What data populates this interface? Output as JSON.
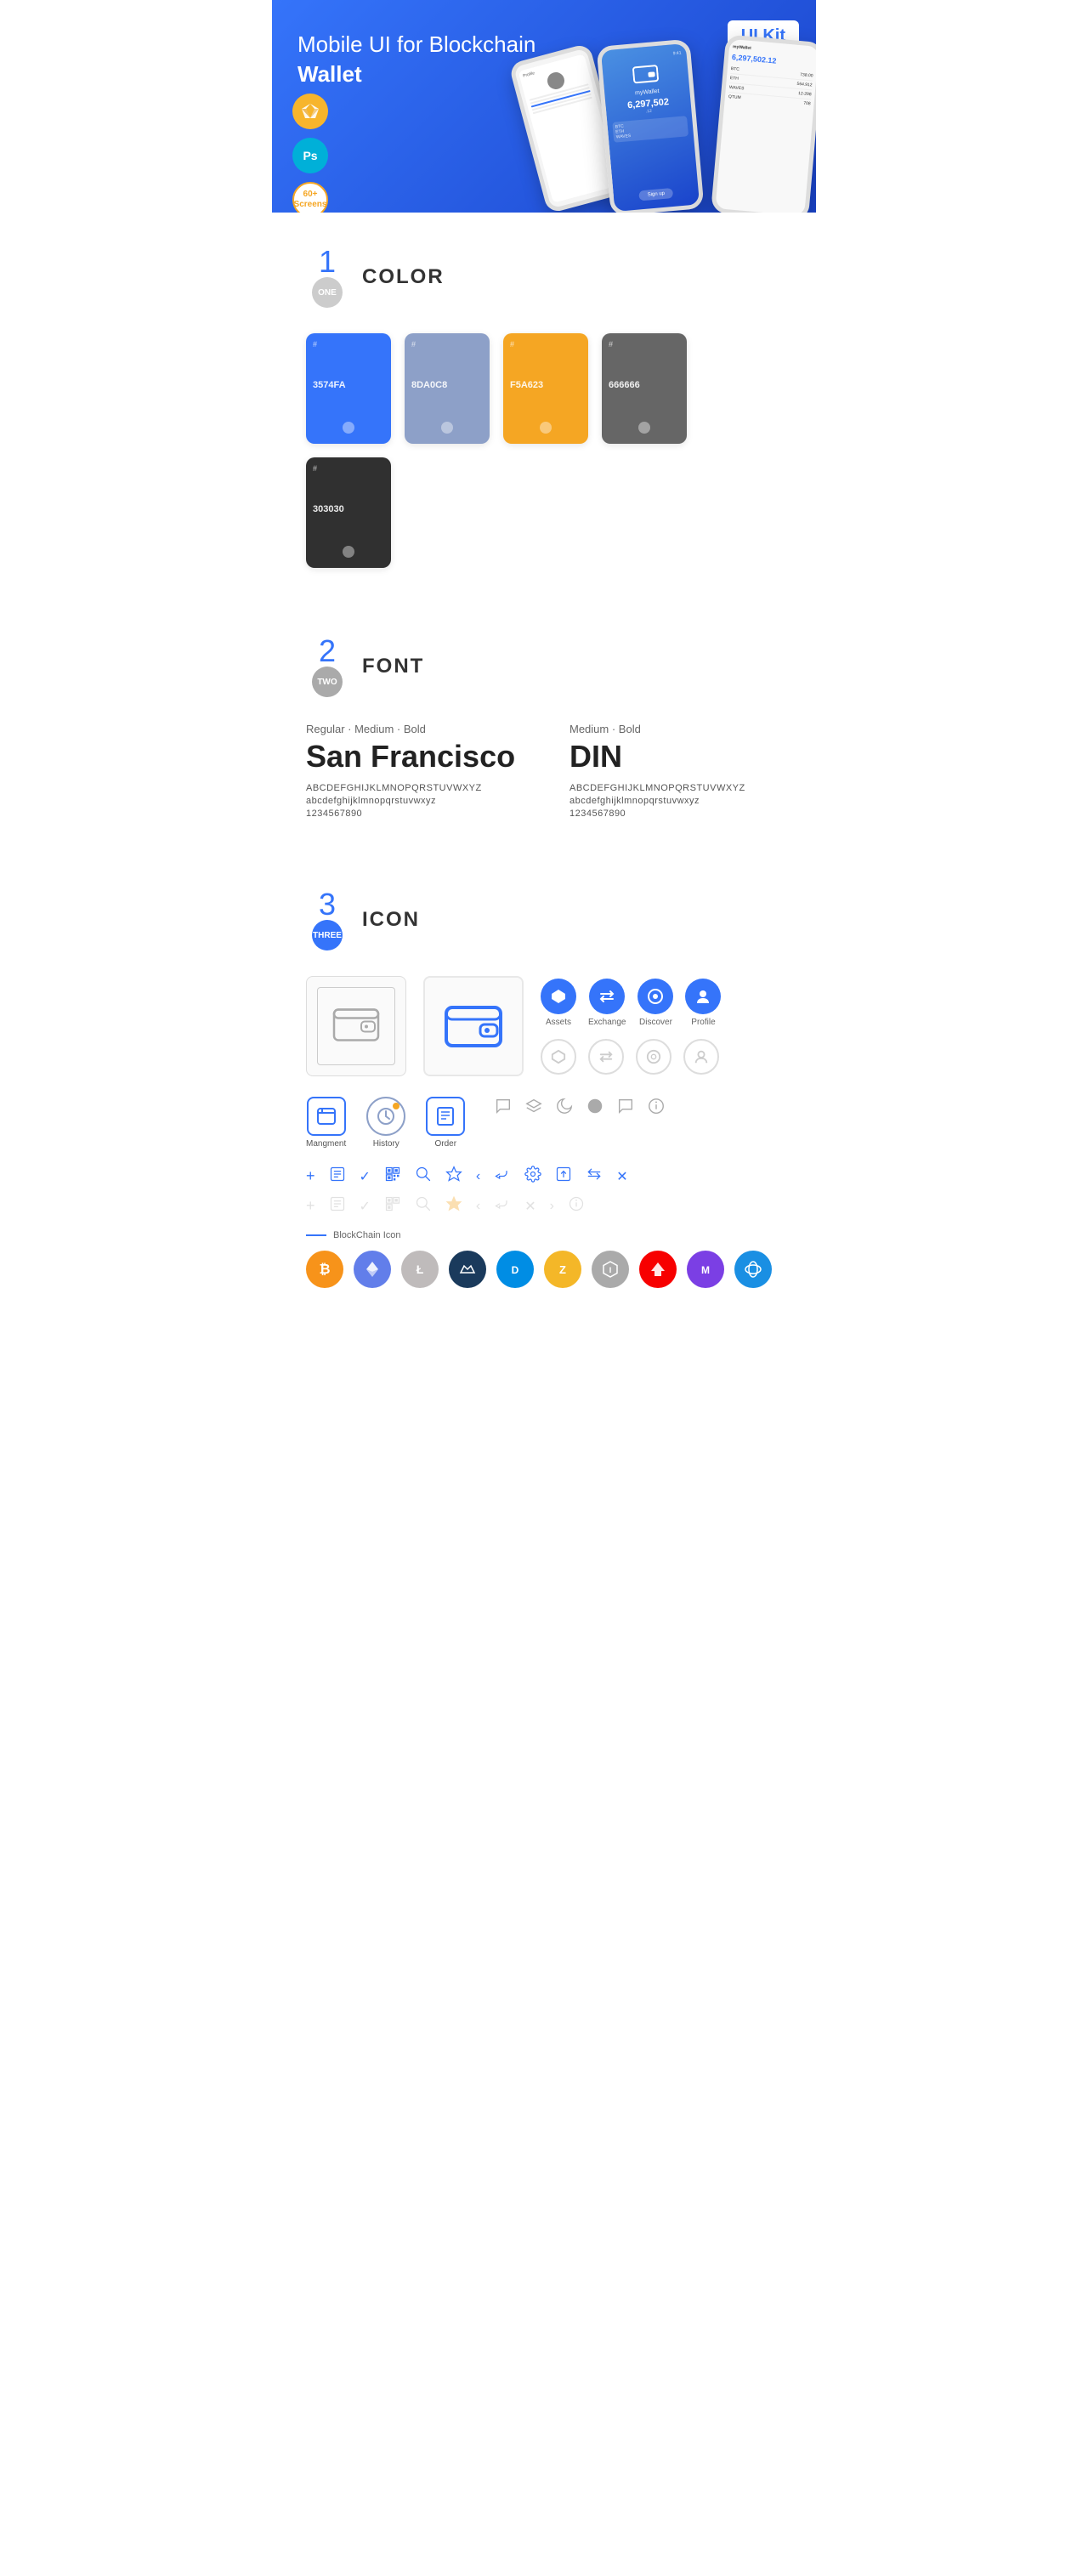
{
  "hero": {
    "title_regular": "Mobile UI for Blockchain ",
    "title_bold": "Wallet",
    "badge": "UI Kit",
    "badges": [
      {
        "label": "Sk",
        "type": "sketch"
      },
      {
        "label": "Ps",
        "type": "ps"
      },
      {
        "label": "60+\nScreens",
        "type": "screens"
      }
    ]
  },
  "sections": {
    "color": {
      "number": "1",
      "number_label": "ONE",
      "title": "COLOR",
      "swatches": [
        {
          "hex": "#3574FA",
          "code": "#3574FA",
          "bg": "#3574FA"
        },
        {
          "hex": "#8DA0C8",
          "code": "#8DA0C8",
          "bg": "#8DA0C8"
        },
        {
          "hex": "#F5A623",
          "code": "#F5A623",
          "bg": "#F5A623"
        },
        {
          "hex": "#666666",
          "code": "#666666",
          "bg": "#666666"
        },
        {
          "hex": "#303030",
          "code": "#303030",
          "bg": "#303030"
        }
      ]
    },
    "font": {
      "number": "2",
      "number_label": "TWO",
      "title": "FONT",
      "fonts": [
        {
          "style": "Regular · Medium · Bold",
          "name": "San Francisco",
          "uppercase": "ABCDEFGHIJKLMNOPQRSTUVWXYZ",
          "lowercase": "abcdefghijklmnopqrstuvwxyz",
          "numbers": "1234567890"
        },
        {
          "style": "Medium · Bold",
          "name": "DIN",
          "uppercase": "ABCDEFGHIJKLMNOPQRSTUVWXYZ",
          "lowercase": "abcdefghijklmnopqrstuvwxyz",
          "numbers": "1234567890"
        }
      ]
    },
    "icon": {
      "number": "3",
      "number_label": "THREE",
      "title": "ICON",
      "nav_icons": [
        {
          "label": "Assets",
          "symbol": "◆"
        },
        {
          "label": "Exchange",
          "symbol": "⇄"
        },
        {
          "label": "Discover",
          "symbol": "◉"
        },
        {
          "label": "Profile",
          "symbol": "👤"
        }
      ],
      "app_icons": [
        {
          "label": "Mangment",
          "type": "box"
        },
        {
          "label": "History",
          "type": "clock"
        },
        {
          "label": "Order",
          "type": "list"
        }
      ],
      "blockchain_label": "BlockChain Icon",
      "crypto_coins": [
        {
          "label": "BTC",
          "type": "btc"
        },
        {
          "label": "ETH",
          "type": "eth"
        },
        {
          "label": "LTC",
          "type": "ltc"
        },
        {
          "label": "WAVES",
          "type": "waves"
        },
        {
          "label": "DASH",
          "type": "dash"
        },
        {
          "label": "ZEC",
          "type": "zcash"
        },
        {
          "label": "IOTA",
          "type": "iota"
        },
        {
          "label": "ARK",
          "type": "ark"
        },
        {
          "label": "MATIC",
          "type": "matic"
        },
        {
          "label": "XRP",
          "type": "other"
        }
      ]
    }
  },
  "utility_icons": [
    "+",
    "⊞",
    "✓",
    "⊡",
    "🔍",
    "☆",
    "<",
    "⟨",
    "⚙",
    "⬡",
    "⇌",
    "✕"
  ],
  "misc_icons": [
    "💬",
    "☰",
    "◑",
    "●",
    "💬",
    "ℹ"
  ]
}
